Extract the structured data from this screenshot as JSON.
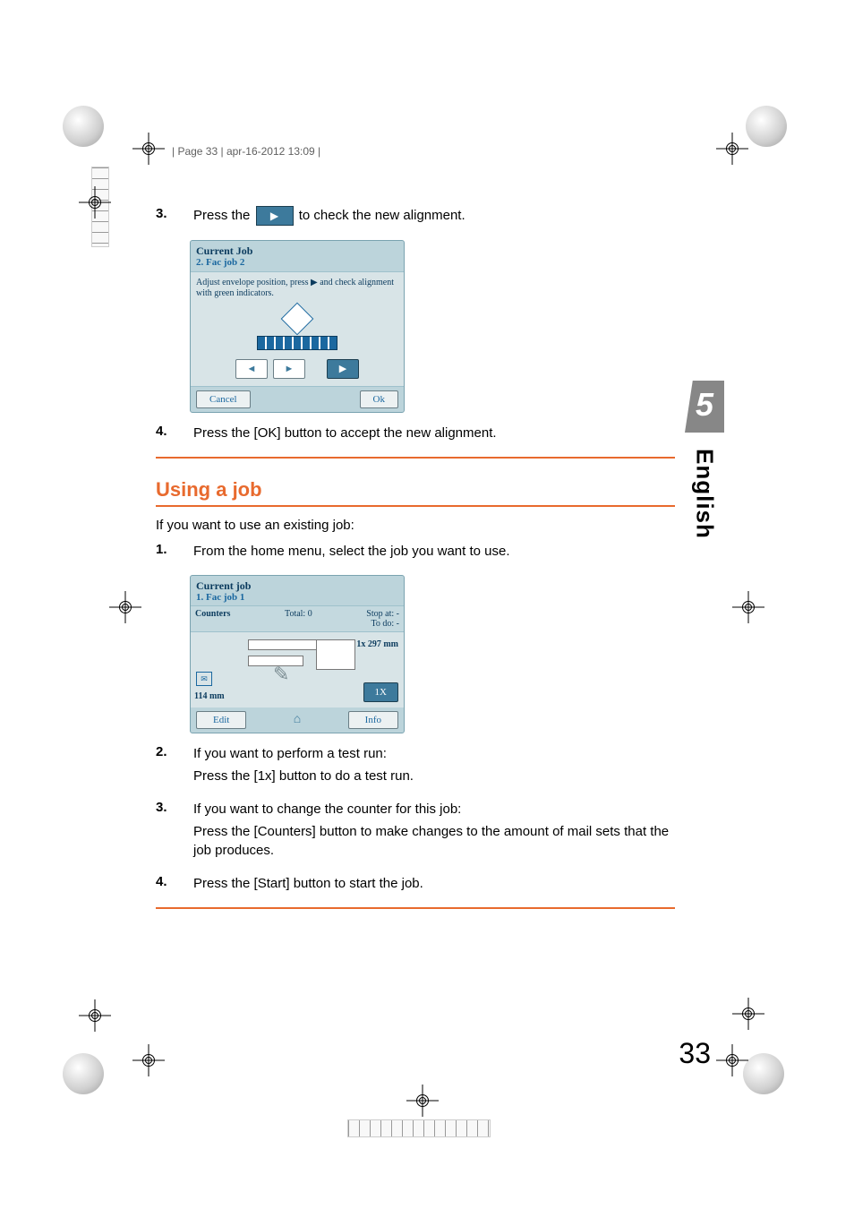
{
  "page": {
    "header_line": "| Page 33 | apr-16-2012 13:09 |",
    "number": "33",
    "chapter_tab": "5",
    "language_tab": "English"
  },
  "steps_a": {
    "num3": "3.",
    "body3_pre": "Press the ",
    "body3_post": " to check the new alignment.",
    "num4": "4.",
    "body4": "Press the [OK] button to accept the new alignment."
  },
  "ui1": {
    "title": "Current Job",
    "subtitle": "2. Fac job 2",
    "instruction": "Adjust envelope position, press ▶ and check alignment with green indicators.",
    "left_arrow": "◄",
    "right_arrow": "►",
    "play": "▶",
    "cancel": "Cancel",
    "ok": "Ok"
  },
  "section_heading": "Using a job",
  "intro_text": "If you want to use an existing job:",
  "steps_b": {
    "num1": "1.",
    "body1": "From the home menu, select the job you want to use.",
    "num2": "2.",
    "body2_a": "If you want to perform a test run:",
    "body2_b": "Press the [1x] button to do a test run.",
    "num3": "3.",
    "body3_a": "If you want to change the counter for this job:",
    "body3_b": "Press the [Counters] button to make changes to the amount of mail sets that the job produces.",
    "num4": "4.",
    "body4": "Press the [Start] button to start the job."
  },
  "ui2": {
    "title": "Current job",
    "subtitle": "1. Fac job 1",
    "counters_label": "Counters",
    "total_label": "Total:",
    "total_value": "0",
    "stop_at_label": "Stop at:",
    "stop_at_value": "-",
    "todo_label": "To do:",
    "todo_value": "-",
    "paper_size": "1x 297 mm",
    "env_width": "114 mm",
    "run_btn": "1X",
    "edit_btn": "Edit",
    "info_btn": "Info",
    "home_icon": "⌂"
  },
  "icons": {
    "play_glyph": "▶"
  },
  "chart_data": null
}
